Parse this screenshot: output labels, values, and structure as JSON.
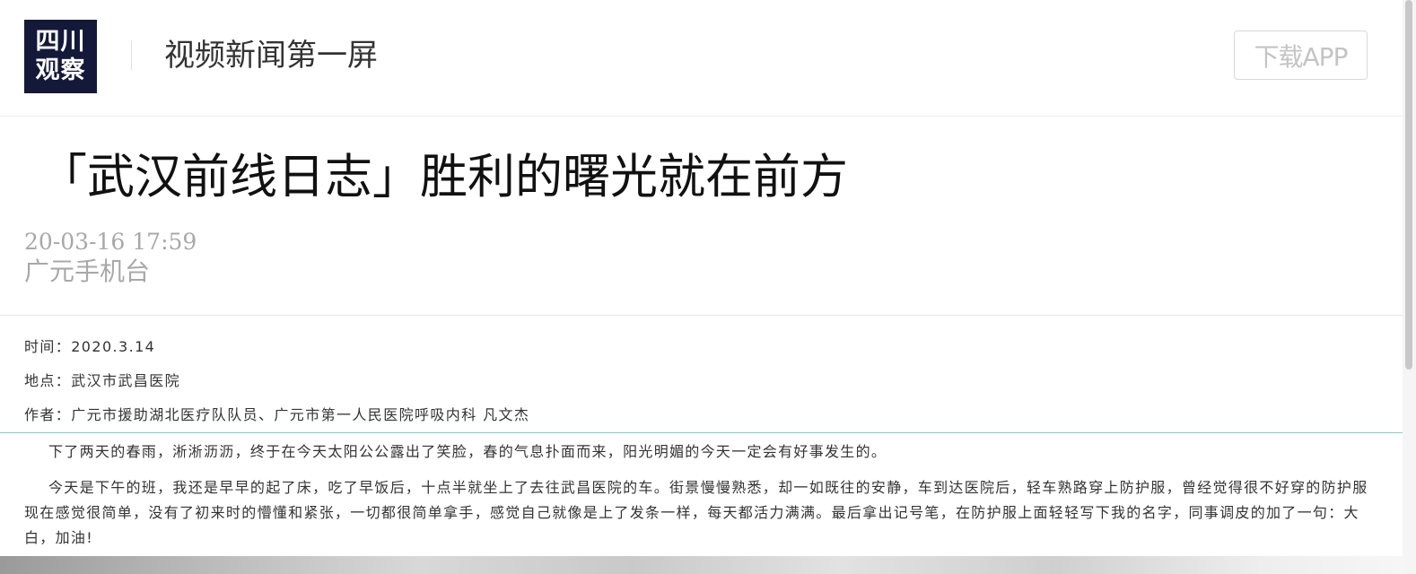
{
  "header": {
    "logo_line1": "四川",
    "logo_line2": "观察",
    "site_name": "视频新闻第一屏",
    "download_label": "下载APP"
  },
  "article": {
    "title": "「武汉前线日志」胜利的曙光就在前方",
    "publish_time": "20-03-16 17:59",
    "source": "广元手机台",
    "meta": [
      "时间：2020.3.14",
      "地点：武汉市武昌医院",
      "作者：广元市援助湖北医疗队队员、广元市第一人民医院呼吸内科 凡文杰"
    ],
    "paragraphs": [
      "下了两天的春雨，淅淅沥沥，终于在今天太阳公公露出了笑脸，春的气息扑面而来，阳光明媚的今天一定会有好事发生的。",
      "今天是下午的班，我还是早早的起了床，吃了早饭后，十点半就坐上了去往武昌医院的车。街景慢慢熟悉，却一如既往的安静，车到达医院后，轻车熟路穿上防护服，曾经觉得很不好穿的防护服现在感觉很简单，没有了初来时的懵懂和紧张，一切都很简单拿手，感觉自己就像是上了发条一样，每天都活力满满。最后拿出记号笔，在防护服上面轻轻写下我的名字，同事调皮的加了一句：大白，加油!"
    ]
  },
  "colors": {
    "logo_bg": "#14193a",
    "accent_rule": "#7fcfcc",
    "muted_text": "#a8a8a8"
  }
}
